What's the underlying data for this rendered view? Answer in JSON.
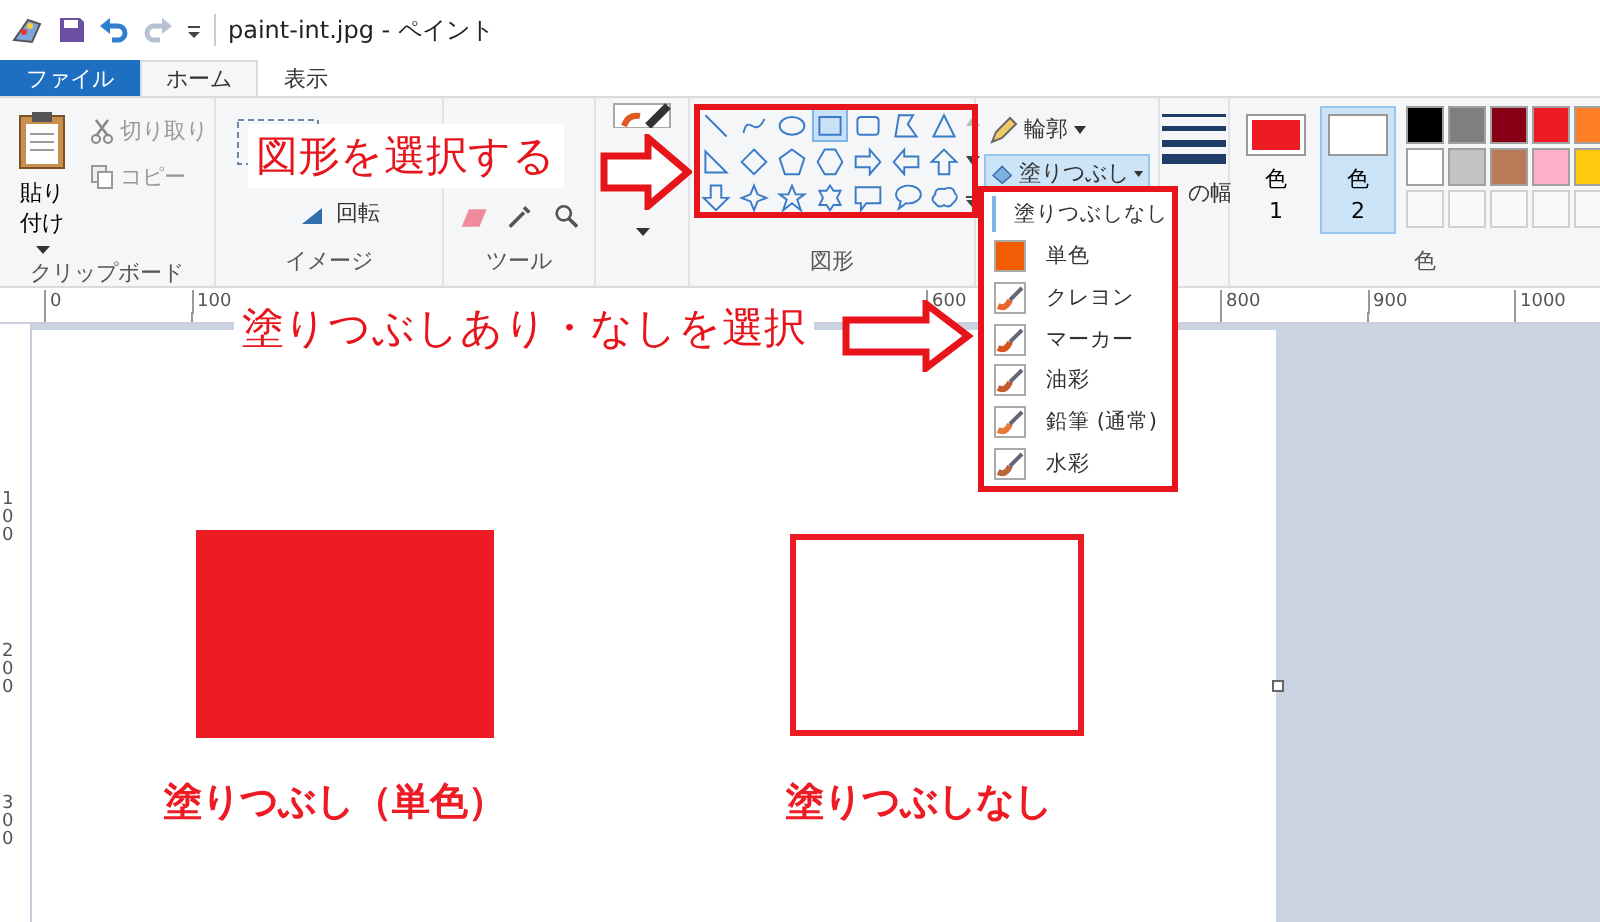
{
  "title_bar": {
    "title": "paint-int.jpg - ペイント"
  },
  "tabs": [
    {
      "label": "ファイル",
      "kind": "file",
      "selected": false
    },
    {
      "label": "ホーム",
      "kind": "tab",
      "selected": true
    },
    {
      "label": "表示",
      "kind": "tab",
      "selected": false
    }
  ],
  "clipboard": {
    "paste": "貼り付け",
    "cut": {
      "label": "切り取り",
      "disabled": true
    },
    "copy": {
      "label": "コピー",
      "disabled": true
    },
    "group_label": "クリップボード"
  },
  "image": {
    "rotate": "回転",
    "group_label": "イメージ"
  },
  "tools": {
    "group_label": "ツール"
  },
  "shapes": {
    "group_label": "図形",
    "items": [
      {
        "kind": "line",
        "selected": false
      },
      {
        "kind": "curve",
        "selected": false
      },
      {
        "kind": "oval",
        "selected": false
      },
      {
        "kind": "rectangle",
        "selected": true
      },
      {
        "kind": "rounded-rectangle",
        "selected": false
      },
      {
        "kind": "polygon",
        "selected": false
      },
      {
        "kind": "triangle",
        "selected": false
      },
      {
        "kind": "right-triangle",
        "selected": false
      },
      {
        "kind": "diamond",
        "selected": false
      },
      {
        "kind": "pentagon",
        "selected": false
      },
      {
        "kind": "hexagon",
        "selected": false
      },
      {
        "kind": "right-arrow",
        "selected": false
      },
      {
        "kind": "left-arrow",
        "selected": false
      },
      {
        "kind": "up-arrow",
        "selected": false
      },
      {
        "kind": "down-arrow",
        "selected": false
      },
      {
        "kind": "four-point-star",
        "selected": false
      },
      {
        "kind": "five-point-star",
        "selected": false
      },
      {
        "kind": "six-point-star",
        "selected": false
      },
      {
        "kind": "rectangle-callout",
        "selected": false
      },
      {
        "kind": "oval-callout",
        "selected": false
      },
      {
        "kind": "cloud-callout",
        "selected": false
      }
    ]
  },
  "outline": {
    "label": "輪郭"
  },
  "fill": {
    "label": "塗りつぶし",
    "expanded": true
  },
  "size": {
    "label": "の幅"
  },
  "colors": {
    "group_label": "色",
    "color1": {
      "label": "色",
      "number": "1",
      "color": "#ed1c24",
      "selected": false
    },
    "color2": {
      "label": "色",
      "number": "2",
      "color": "#ffffff",
      "selected": true
    },
    "palette": [
      {
        "color": "#000000"
      },
      {
        "color": "#7f7f7f"
      },
      {
        "color": "#880015"
      },
      {
        "color": "#ed1c24"
      },
      {
        "color": "#ff7f27"
      },
      {
        "color": "#ffffff"
      },
      {
        "color": "#c3c3c3"
      },
      {
        "color": "#b97a57"
      },
      {
        "color": "#ffaec9"
      },
      {
        "color": "#ffc90e"
      }
    ]
  },
  "fill_menu": [
    {
      "label": "塗りつぶしなし",
      "kind": "none",
      "selected": true
    },
    {
      "label": "単色",
      "kind": "solid",
      "selected": false
    },
    {
      "label": "クレヨン",
      "kind": "crayon",
      "selected": false
    },
    {
      "label": "マーカー",
      "kind": "marker",
      "selected": false
    },
    {
      "label": "油彩",
      "kind": "oil",
      "selected": false
    },
    {
      "label": "鉛筆 (通常)",
      "kind": "pencil",
      "selected": false
    },
    {
      "label": "水彩",
      "kind": "watercolor",
      "selected": false
    }
  ],
  "rulers": {
    "horizontal": [
      "0",
      "100",
      "600",
      "800",
      "900",
      "1000"
    ],
    "vertical": [
      "100",
      "200",
      "300"
    ]
  },
  "canvas": {
    "shapes": [
      {
        "kind": "filled",
        "caption": "塗りつぶし（単色）"
      },
      {
        "kind": "outline",
        "caption": "塗りつぶしなし"
      }
    ]
  },
  "annotations": [
    {
      "text": "図形を選択する"
    },
    {
      "text": "塗りつぶしあり・なしを選択"
    }
  ]
}
